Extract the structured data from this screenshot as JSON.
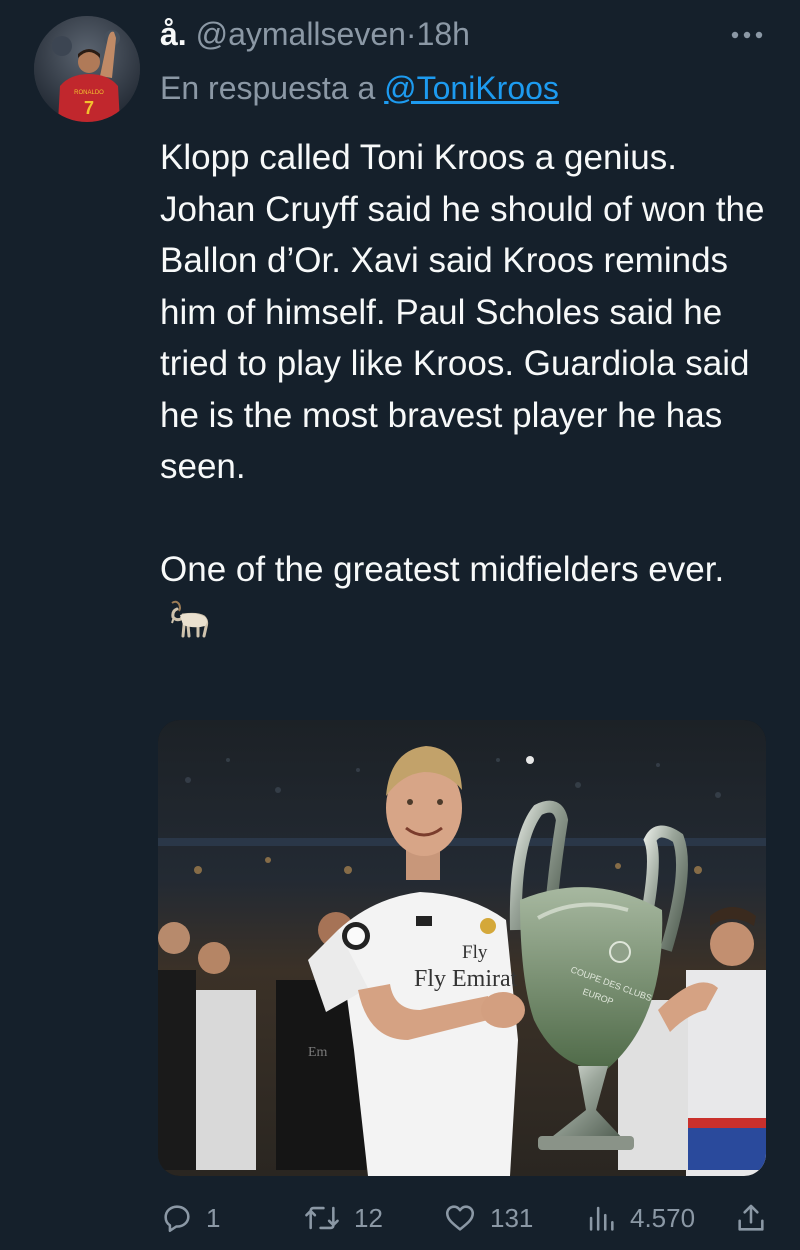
{
  "tweet": {
    "display_name": "å.",
    "handle": "@aymallseven",
    "separator": "·",
    "time": "18h",
    "reply_prefix": "En respuesta a",
    "reply_to": "@ToniKroos",
    "text_paragraph_1": "Klopp called Toni Kroos a genius. Johan Cruyff said he should of won the Ballon d’Or. Xavi said Kroos reminds him of himself. Paul Scholes said he tried to play like Kroos. Guardiola said he is the most bravest player he has seen.",
    "text_paragraph_2": "One of the greatest midfielders ever.",
    "emoji_icon": "goat-icon",
    "more_icon": "more-dots-icon",
    "avatar": {
      "jersey_name": "RONALDO",
      "jersey_number": "7"
    },
    "media": {
      "sponsor_text": "Fly Emirat",
      "secondary_sponsor": "Em",
      "trophy_text": "COUPE DES CLUBS",
      "trophy_text_2": "EUROP",
      "content": "player holding trophy"
    }
  },
  "actions": {
    "reply": {
      "icon": "reply-icon",
      "count": "1"
    },
    "retweet": {
      "icon": "retweet-icon",
      "count": "12"
    },
    "like": {
      "icon": "heart-icon",
      "count": "131"
    },
    "views": {
      "icon": "views-icon",
      "count": "4.570"
    },
    "share": {
      "icon": "share-icon"
    }
  },
  "colors": {
    "background": "#15202b",
    "text_primary": "#f7f9f9",
    "text_secondary": "#8b98a5",
    "accent": "#1d9bf0"
  }
}
